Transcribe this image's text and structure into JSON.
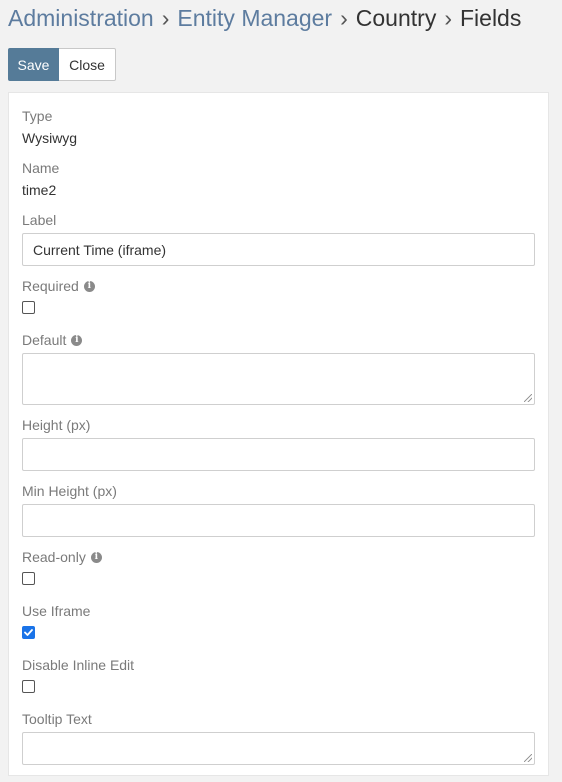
{
  "breadcrumb": {
    "items": [
      "Administration",
      "Entity Manager",
      "Country",
      "Fields"
    ],
    "separator": "›"
  },
  "toolbar": {
    "save_label": "Save",
    "close_label": "Close"
  },
  "fields": {
    "type": {
      "label": "Type",
      "value": "Wysiwyg"
    },
    "name": {
      "label": "Name",
      "value": "time2"
    },
    "label": {
      "label": "Label",
      "value": "Current Time (iframe)"
    },
    "required": {
      "label": "Required",
      "checked": false,
      "info": "i"
    },
    "default": {
      "label": "Default",
      "value": "",
      "info": "i"
    },
    "height": {
      "label": "Height (px)",
      "value": ""
    },
    "min_height": {
      "label": "Min Height (px)",
      "value": ""
    },
    "read_only": {
      "label": "Read-only",
      "checked": false,
      "info": "i"
    },
    "use_iframe": {
      "label": "Use Iframe",
      "checked": true
    },
    "disable_inline_edit": {
      "label": "Disable Inline Edit",
      "checked": false
    },
    "tooltip_text": {
      "label": "Tooltip Text",
      "value": ""
    }
  },
  "colors": {
    "primary": "#557b98",
    "link": "#5d7c9f",
    "checkbox_checked": "#1a73e8"
  }
}
